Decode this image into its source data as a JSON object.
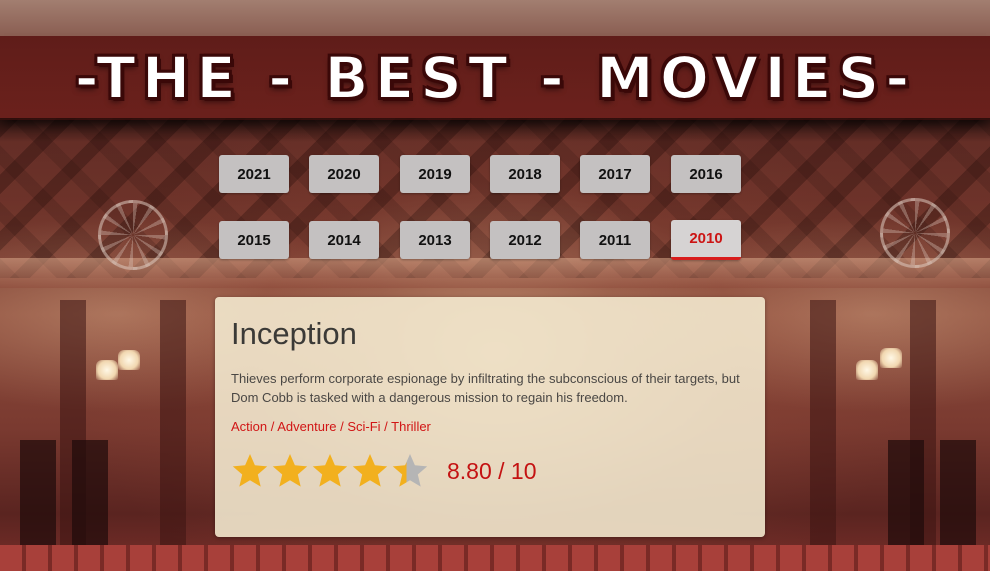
{
  "header": {
    "title": "-THE - BEST - MOVIES-"
  },
  "years": {
    "row1": [
      "2021",
      "2020",
      "2019",
      "2018",
      "2017",
      "2016"
    ],
    "row2": [
      "2015",
      "2014",
      "2013",
      "2012",
      "2011",
      "2010"
    ],
    "selected": "2010"
  },
  "movie": {
    "title": "Inception",
    "synopsis": "Thieves perform corporate espionage by infiltrating the subconscious of their targets, but Dom Cobb is tasked with a dangerous mission to regain his freedom.",
    "genres": "Action / Adventure / Sci-Fi / Thriller",
    "rating_text": "8.80 / 10",
    "rating_value": 8.8,
    "rating_max": 10,
    "stars_total": 5,
    "stars_filled": 4.4
  },
  "colors": {
    "star_filled": "#f2b01e",
    "star_empty": "#b5b5b5",
    "accent_red": "#d11515",
    "button_bg": "#c4c1c1"
  }
}
